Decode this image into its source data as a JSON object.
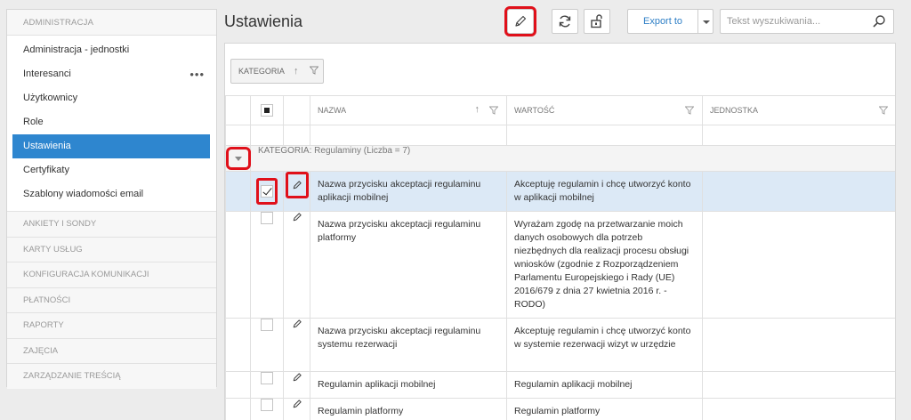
{
  "sidebar": {
    "header": "ADMINISTRACJA",
    "items": [
      {
        "label": "Administracja - jednostki"
      },
      {
        "label": "Interesanci",
        "more": "•••"
      },
      {
        "label": "Użytkownicy"
      },
      {
        "label": "Role"
      },
      {
        "label": "Ustawienia",
        "active": true
      },
      {
        "label": "Certyfikaty"
      },
      {
        "label": "Szablony wiadomości email"
      }
    ],
    "sections": [
      "ANKIETY I SONDY",
      "KARTY USŁUG",
      "KONFIGURACJA KOMUNIKACJI",
      "PŁATNOŚCI",
      "RAPORTY",
      "ZAJĘCIA",
      "ZARZĄDZANIE TREŚCIĄ"
    ]
  },
  "header": {
    "title": "Ustawienia",
    "export_label": "Export to",
    "search_placeholder": "Tekst wyszukiwania..."
  },
  "grid": {
    "group_chip": "KATEGORIA",
    "sort_arrow": "↑",
    "columns": {
      "name": "NAZWA",
      "value": "WARTOŚĆ",
      "unit": "JEDNOSTKA"
    },
    "group_label": "KATEGORIA: Regulaminy (Liczba = 7)",
    "rows": [
      {
        "name": "Nazwa przycisku akceptacji regulaminu aplikacji mobilnej",
        "value": "Akceptuję regulamin i chcę utworzyć konto w aplikacji mobilnej",
        "unit": "",
        "checked": true
      },
      {
        "name": "Nazwa przycisku akceptacji regulaminu platformy",
        "value": "Wyrażam zgodę na przetwarzanie moich danych osobowych dla potrzeb niezbędnych dla realizacji procesu obsługi wniosków (zgodnie z Rozporządzeniem Parlamentu Europejskiego i Rady (UE) 2016/679 z dnia 27 kwietnia 2016 r. - RODO)",
        "unit": "",
        "checked": false
      },
      {
        "name": "Nazwa przycisku akceptacji regulaminu systemu rezerwacji",
        "value": "Akceptuję regulamin i chcę utworzyć konto w systemie rezerwacji wizyt w urzędzie",
        "unit": "",
        "checked": false
      },
      {
        "name": "Regulamin aplikacji mobilnej",
        "value": "Regulamin aplikacji mobilnej",
        "unit": "",
        "checked": false
      },
      {
        "name": "Regulamin platformy",
        "value": "Regulamin platformy",
        "unit": "",
        "checked": false
      }
    ]
  },
  "colors": {
    "accent": "#2e86cf",
    "highlight": "#e0101a",
    "selected_row": "#dce9f6"
  },
  "icons": {
    "edit": "pencil-icon",
    "refresh": "refresh-icon",
    "unlock": "unlock-icon",
    "search": "search-icon",
    "filter": "filter-icon"
  }
}
